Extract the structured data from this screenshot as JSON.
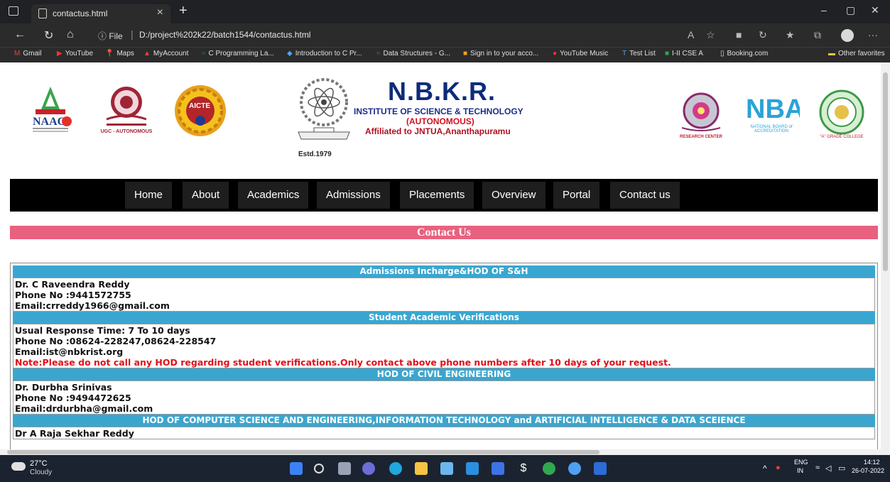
{
  "browser": {
    "tab_title": "contactus.html",
    "tab_close": "×",
    "new_tab": "+",
    "win_min": "–",
    "win_max": "▢",
    "win_close": "✕",
    "info_label": "ⓘ File",
    "url_sep": "|",
    "url": "D:/project%202k22/batch1544/contactus.html",
    "more": "···",
    "bookmarks": [
      {
        "icon": "M",
        "label": "Gmail"
      },
      {
        "icon": "▶",
        "label": "YouTube"
      },
      {
        "icon": "📍",
        "label": "Maps"
      },
      {
        "icon": "▲",
        "label": "MyAccount"
      },
      {
        "icon": "≈",
        "label": "C Programming La..."
      },
      {
        "icon": "◆",
        "label": "Introduction to C Pr..."
      },
      {
        "icon": "≈",
        "label": "Data Structures - G..."
      },
      {
        "icon": "■",
        "label": "Sign in to your acco..."
      },
      {
        "icon": "●",
        "label": "YouTube Music"
      },
      {
        "icon": "T",
        "label": "Test List"
      },
      {
        "icon": "■",
        "label": "I-II CSE A"
      },
      {
        "icon": "▯",
        "label": "Booking.com"
      },
      {
        "icon": "▬",
        "label": "Other favorites"
      }
    ]
  },
  "header": {
    "title": "N.B.K.R.",
    "subtitle": "INSTITUTE OF SCIENCE & TECHNOLOGY",
    "autonomous": "(AUTONOMOUS)",
    "affiliation": "Affiliated to JNTUA,Ananthapuramu",
    "estd": "Estd.1979",
    "naac_text": "NAAC",
    "ugc_caption": "UGC - AUTONOMOUS",
    "aicte_text": "AICTE",
    "rc_caption": "RESEARCH CENTER",
    "nba_text": "NBA",
    "nba_caption": "NATIONAL BOARD of ACCREDITATION",
    "ap_caption": "\"A\" GRADE COLLEGE"
  },
  "nav": [
    "Home",
    "About",
    "Academics",
    "Admissions",
    "Placements",
    "Overview",
    "Portal",
    "Contact us"
  ],
  "contact_title": "Contact Us",
  "sections": [
    {
      "heading": "Admissions Incharge&HOD OF S&H",
      "lines": [
        "Dr. C Raveendra Reddy",
        "Phone No :9441572755",
        "Email:crreddy1966@gmail.com"
      ]
    },
    {
      "heading": "Student Academic Verifications",
      "lines": [
        "Usual Response Time: 7 To 10 days",
        "Phone No :08624-228247,08624-228547",
        "Email:ist@nbkrist.org"
      ],
      "note": "Note:Please do not call any HOD regarding student verifications.Only contact above phone numbers after 10 days of your request."
    },
    {
      "heading": "HOD OF CIVIL ENGINEERING",
      "lines": [
        "Dr. Durbha Srinivas",
        "Phone No :9494472625",
        "Email:drdurbha@gmail.com"
      ]
    },
    {
      "heading": "HOD OF COMPUTER SCIENCE AND ENGINEERING,INFORMATION TECHNOLOGY and ARTIFICIAL INTELLIGENCE & DATA SCEIENCE",
      "lines": [
        "Dr A Raja Sekhar Reddy"
      ]
    }
  ],
  "taskbar": {
    "temp": "27°C",
    "weather": "Cloudy",
    "lang_top": "ENG",
    "lang_bottom": "IN",
    "time": "14:12",
    "date": "26-07-2022"
  },
  "colors": {
    "contact_bar": "#e8617f",
    "section_head": "#3aa6cf",
    "note_text": "#e0101a",
    "nbkr_title": "#0d2b7a"
  }
}
